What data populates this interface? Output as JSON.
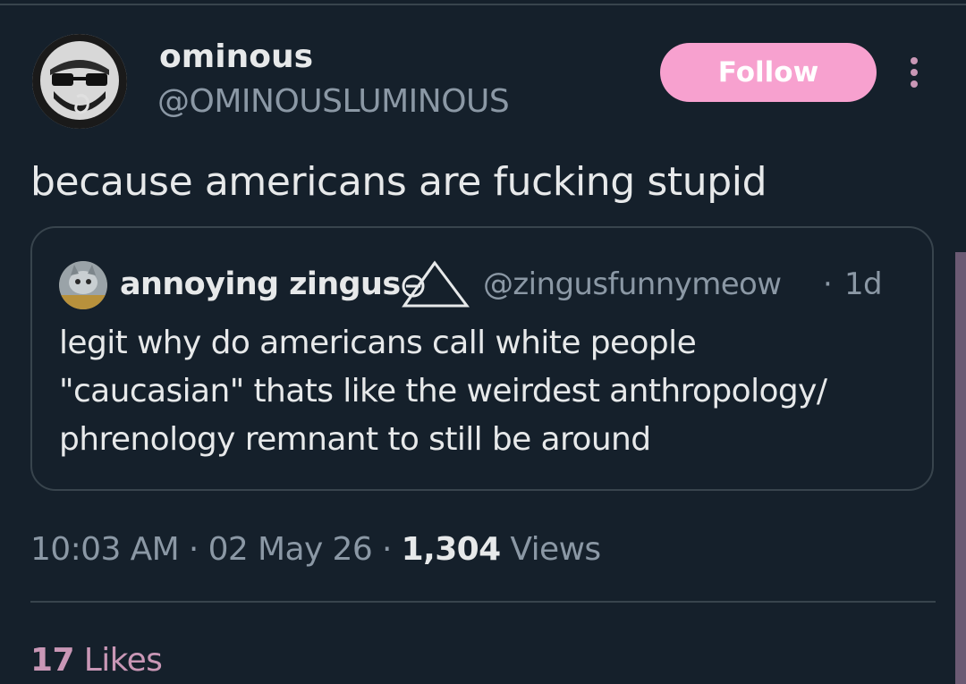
{
  "author": {
    "display_name": "ominous",
    "handle": "@OMINOUSLUMINOUS",
    "avatar_icon": "masked-face-avatar"
  },
  "actions": {
    "follow_label": "Follow",
    "more_icon": "more-vertical-icon"
  },
  "tweet": {
    "text": "because americans are fucking stupid"
  },
  "quoted_tweet": {
    "display_name": "annoying zingus",
    "name_symbol_icon": "triangle-symbol-icon",
    "handle": "@zingusfunnymeow",
    "separator": "·",
    "time": "1d",
    "lines": [
      "legit why do americans call white people",
      "\"caucasian\" thats like the weirdest anthropology/",
      "phrenology remnant to still be around"
    ]
  },
  "meta": {
    "time": "10:03 AM",
    "separator": "·",
    "date": "02 May 26",
    "views_count": "1,304",
    "views_label": "Views"
  },
  "likes": {
    "count": "17",
    "label": "Likes"
  },
  "colors": {
    "background": "#15202b",
    "text_primary": "#e7e9ea",
    "text_secondary": "#8b98a5",
    "border": "#38444d",
    "accent_pink": "#f7a1cf",
    "accent_muted": "#c997b6"
  }
}
